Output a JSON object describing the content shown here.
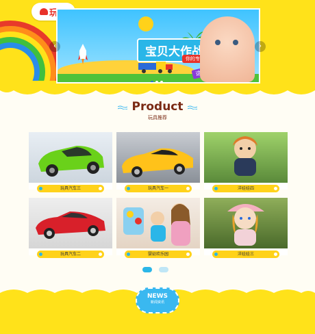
{
  "header": {
    "logo_text": "玩具"
  },
  "banner": {
    "headline": "宝贝大作战",
    "tag1": "你的专属玩具",
    "tag2": "这样带的娃娃聪明",
    "prev_label": "‹",
    "next_label": "›",
    "slide_count": 3,
    "active_slide": 1
  },
  "section": {
    "title_en": "Product",
    "title_cn": "玩具推荐"
  },
  "products": [
    {
      "label": "玩具汽车三"
    },
    {
      "label": "玩具汽车一"
    },
    {
      "label": "洋娃娃四"
    },
    {
      "label": "玩具汽车二"
    },
    {
      "label": "婴幼欢乐园"
    },
    {
      "label": "洋娃娃三"
    }
  ],
  "news": {
    "title_en": "NEWS",
    "title_cn": "新闻资讯"
  },
  "colors": {
    "brand_yellow": "#ffe21a",
    "accent_red": "#e8322a",
    "title_brown": "#7a2a14",
    "accent_blue": "#3ab8f0"
  }
}
